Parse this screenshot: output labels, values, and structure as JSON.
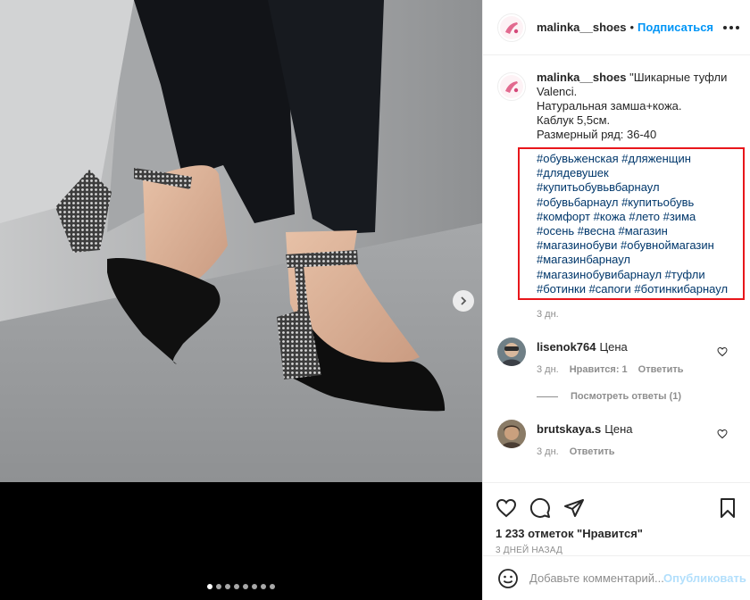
{
  "post": {
    "username": "malinka__shoes",
    "follow_label": "Подписаться",
    "separator": "•",
    "caption_lines": [
      "\"Шикарные туфли",
      "Valenci.",
      "Натуральная замша+кожа.",
      "Каблук 5,5см.",
      "Размерный ряд: 36-40"
    ],
    "hashtag_lines": [
      "#обувьженская #дляженщин",
      "#длядевушек",
      "#купитьобувьвбарнаул",
      "#обувьбарнаул #купитьобувь",
      "#комфорт #кожа #лето #зима",
      "#осень #весна #магазин",
      "#магазинобуви #обувноймагазин",
      "#магазинбарнаул",
      "#магазинобувибарнаул #туфли",
      "#ботинки #сапоги #ботинкибарнаул"
    ],
    "caption_time": "3 дн.",
    "highlight_color": "#e8161b"
  },
  "comments": [
    {
      "username": "lisenok764",
      "text": "Цена",
      "time": "3 дн.",
      "likes_label": "Нравится: 1",
      "reply_label": "Ответить",
      "view_replies_label": "Посмотреть ответы (1)"
    },
    {
      "username": "brutskaya.s",
      "text": "Цена",
      "time": "3 дн.",
      "reply_label": "Ответить"
    }
  ],
  "stats": {
    "likes_text": "1 233 отметок \"Нравится\"",
    "posted_ago": "3 ДНЕЙ НАЗАД"
  },
  "composer": {
    "placeholder": "Добавьте комментарий...",
    "publish_label": "Опубликовать"
  },
  "carousel": {
    "slide_count": 8,
    "active_index": 0
  },
  "icons": {
    "next": "chevron-right-icon",
    "more": "more-options-icon",
    "like": "heart-icon",
    "comment": "comment-icon",
    "share": "share-icon",
    "save": "bookmark-icon",
    "emoji": "emoji-icon"
  },
  "colors": {
    "link": "#00376b",
    "follow": "#0095f6",
    "muted": "#8e8e8e"
  }
}
